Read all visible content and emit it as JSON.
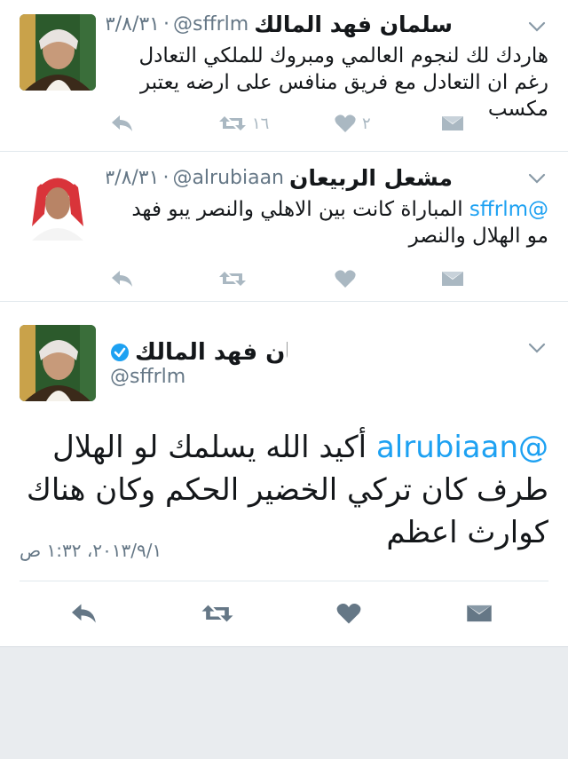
{
  "tweets": [
    {
      "name": "سلمان فهد المالك",
      "handle": "@sffrlm",
      "date": "٢٠١٣/٨/٣١",
      "text": "هاردك لك لنجوم العالمي ومبروك للملكي التعادل رغم ان التعادل مع فريق منافس على ارضه يعتبر مكسب",
      "retweets": "١٦",
      "likes": "٢"
    },
    {
      "name": "مشعل الربيعان",
      "handle": "@alrubiaan",
      "date": "٢٠١٣/٨/٣١",
      "mention": "@sffrlm",
      "text": " المباراة كانت بين الاهلي والنصر يبو فهد مو الهلال والنصر"
    }
  ],
  "main_tweet": {
    "name": "سلمان فهد المالك",
    "handle": "@sffrlm",
    "mention": "@alrubiaan",
    "text": " أكيد الله يسلمك لو الهلال طرف كان تركي الخضير الحكم وكان هناك كوارث اعظم",
    "timestamp": "٢٠١٣/٩/١، ١:٣٢ ص"
  },
  "colors": {
    "accent": "#1da1f2",
    "icon_gray": "#aab8c2",
    "dark_icon": "#657786"
  },
  "icons": [
    "chevron-down-icon",
    "reply-icon",
    "retweet-icon",
    "heart-icon",
    "message-icon",
    "verified-icon"
  ]
}
